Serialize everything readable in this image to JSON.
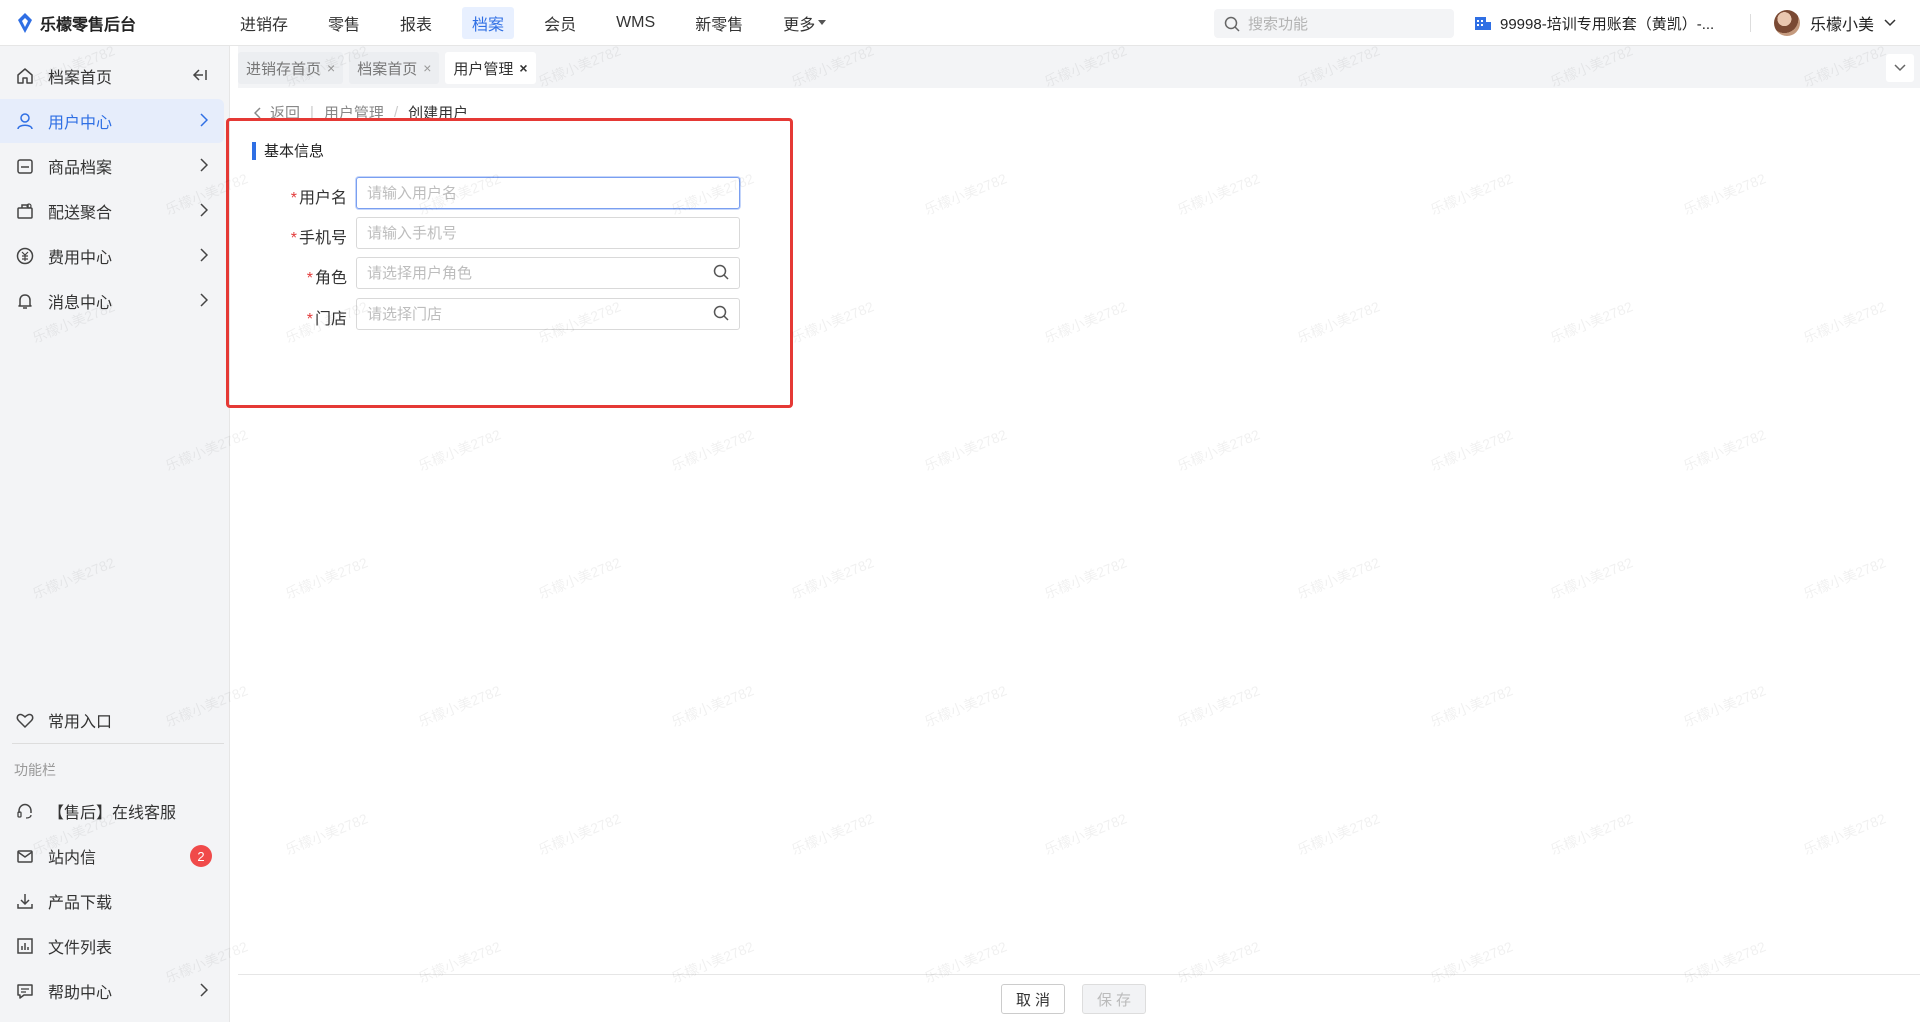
{
  "app": {
    "title": "乐檬零售后台"
  },
  "topnav": {
    "items": [
      "进销存",
      "零售",
      "报表",
      "档案",
      "会员",
      "WMS",
      "新零售",
      "更多"
    ],
    "active_index": 3
  },
  "search": {
    "placeholder": "搜索功能"
  },
  "account": {
    "label": "99998-培训专用账套（黄凯）-..."
  },
  "user": {
    "name": "乐檬小美"
  },
  "sidebar": {
    "items": [
      {
        "label": "档案首页",
        "icon": "home-icon"
      },
      {
        "label": "用户中心",
        "icon": "user-icon"
      },
      {
        "label": "商品档案",
        "icon": "goods-icon"
      },
      {
        "label": "配送聚合",
        "icon": "delivery-icon"
      },
      {
        "label": "费用中心",
        "icon": "fee-icon"
      },
      {
        "label": "消息中心",
        "icon": "bell-icon"
      }
    ],
    "favorites": "常用入口",
    "section": "功能栏",
    "tools": [
      {
        "label": "【售后】在线客服",
        "icon": "headset-icon"
      },
      {
        "label": "站内信",
        "icon": "mail-icon",
        "badge": "2"
      },
      {
        "label": "产品下载",
        "icon": "download-icon"
      },
      {
        "label": "文件列表",
        "icon": "chart-icon"
      },
      {
        "label": "帮助中心",
        "icon": "help-icon"
      }
    ]
  },
  "tabs": [
    {
      "label": "进销存首页"
    },
    {
      "label": "档案首页"
    },
    {
      "label": "用户管理"
    }
  ],
  "tab_close": "×",
  "breadcrumb": {
    "back": "返回",
    "parent": "用户管理",
    "current": "创建用户"
  },
  "form": {
    "section_title": "基本信息",
    "fields": [
      {
        "label": "用户名",
        "placeholder": "请输入用户名",
        "required": true
      },
      {
        "label": "手机号",
        "placeholder": "请输入手机号",
        "required": true
      },
      {
        "label": "角色",
        "placeholder": "请选择用户角色",
        "required": true
      },
      {
        "label": "门店",
        "placeholder": "请选择门店",
        "required": true
      }
    ],
    "required_mark": "*"
  },
  "footer": {
    "cancel": "取消",
    "save": "保存"
  },
  "watermark": "乐檬小美2782",
  "colors": {
    "accent": "#2f6fe4",
    "required": "#e23b3b",
    "highlight": "#e53935",
    "badge": "#f04a4a"
  }
}
